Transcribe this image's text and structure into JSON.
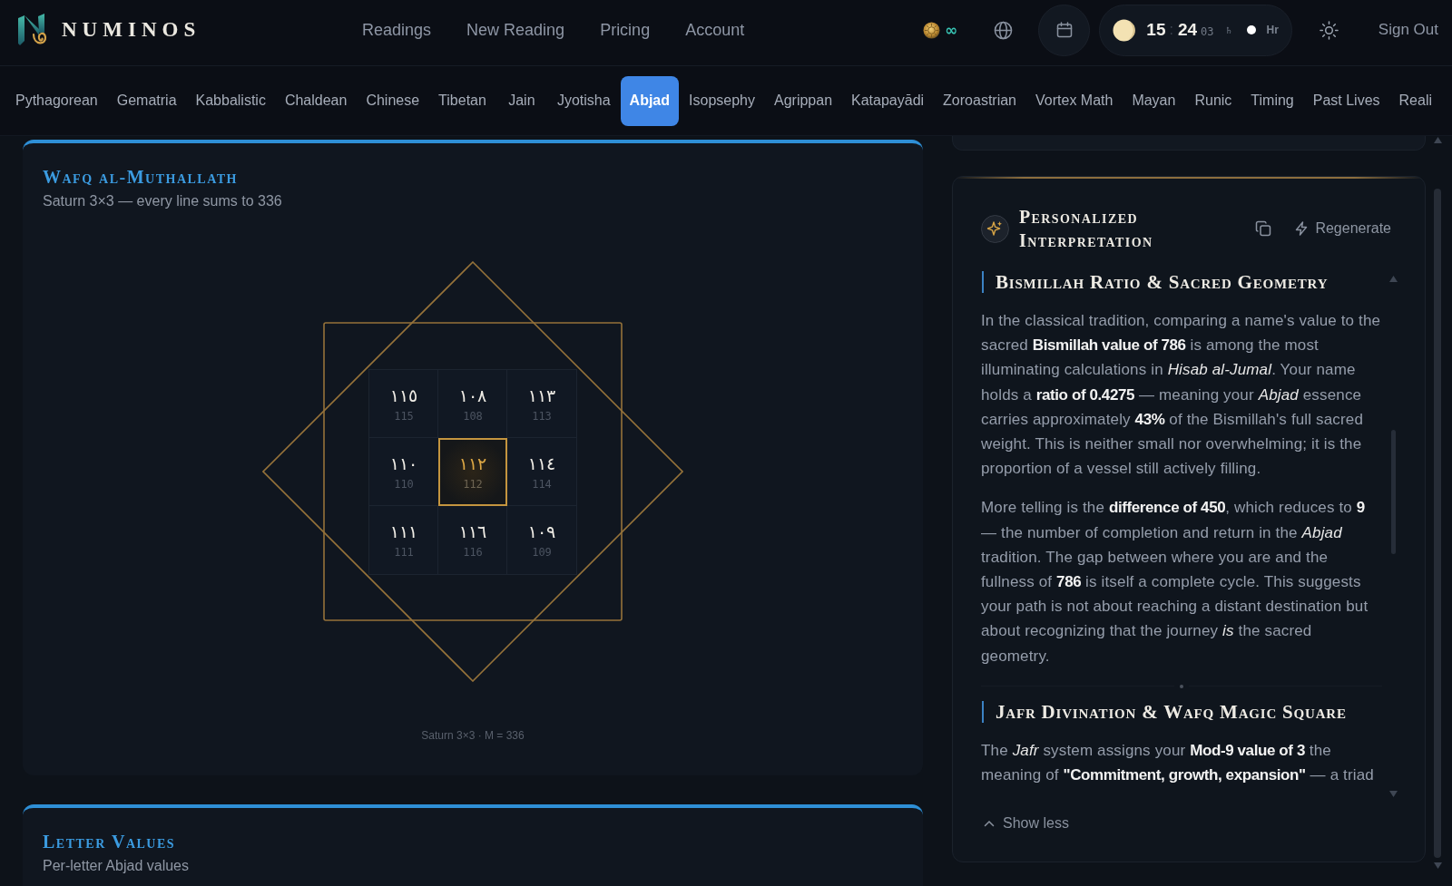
{
  "header": {
    "brand": "NUMINOS",
    "nav": [
      "Readings",
      "New Reading",
      "Pricing",
      "Account"
    ],
    "credits": "∞",
    "clock": {
      "hours": "15",
      "separator": ":",
      "minutes": "24",
      "seconds": "03",
      "planet": "♄",
      "hour_label": "Hr"
    },
    "sign_out": "Sign Out"
  },
  "systems_tabs": [
    {
      "label": "Pythagorean",
      "selected": false
    },
    {
      "label": "Gematria",
      "selected": false
    },
    {
      "label": "Kabbalistic",
      "selected": false
    },
    {
      "label": "Chaldean",
      "selected": false
    },
    {
      "label": "Chinese",
      "selected": false
    },
    {
      "label": "Tibetan",
      "selected": false
    },
    {
      "label": "Jain",
      "selected": false
    },
    {
      "label": "Jyotisha",
      "selected": false
    },
    {
      "label": "Abjad",
      "selected": true
    },
    {
      "label": "Isopsephy",
      "selected": false
    },
    {
      "label": "Agrippan",
      "selected": false
    },
    {
      "label": "Katapayādi",
      "selected": false
    },
    {
      "label": "Zoroastrian",
      "selected": false
    },
    {
      "label": "Vortex Math",
      "selected": false
    },
    {
      "label": "Mayan",
      "selected": false
    },
    {
      "label": "Runic",
      "selected": false
    },
    {
      "label": "Timing",
      "selected": false
    },
    {
      "label": "Past Lives",
      "selected": false
    },
    {
      "label": "Reali",
      "selected": false
    }
  ],
  "wafq_card": {
    "title": "Wafq al-Muthallath",
    "subtitle": "Saturn 3×3 — every line sums to 336",
    "rows": [
      {
        "cells": [
          {
            "arabic": "١١٥",
            "number": "115",
            "highlighted": false
          },
          {
            "arabic": "١٠٨",
            "number": "108",
            "highlighted": false
          },
          {
            "arabic": "١١٣",
            "number": "113",
            "highlighted": false
          }
        ]
      },
      {
        "cells": [
          {
            "arabic": "١١٠",
            "number": "110",
            "highlighted": false
          },
          {
            "arabic": "١١٢",
            "number": "112",
            "highlighted": true
          },
          {
            "arabic": "١١٤",
            "number": "114",
            "highlighted": false
          }
        ]
      },
      {
        "cells": [
          {
            "arabic": "١١١",
            "number": "111",
            "highlighted": false
          },
          {
            "arabic": "١١٦",
            "number": "116",
            "highlighted": false
          },
          {
            "arabic": "١٠٩",
            "number": "109",
            "highlighted": false
          }
        ]
      }
    ],
    "caption": "Saturn 3×3 · M = 336"
  },
  "letter_values_card": {
    "title": "Letter Values",
    "subtitle": "Per-letter Abjad values"
  },
  "interpretation": {
    "title": "Personalized Interpretation",
    "regenerate": "Regenerate",
    "sections": [
      {
        "heading": "Bismillah Ratio & Sacred Geometry",
        "paragraphs": [
          "In the classical tradition, comparing a name's value to the sacred **Bismillah value of 786** is among the most illuminating calculations in *Hisab al-Jumal*. Your name holds a **ratio of 0.4275** — meaning your *Abjad* essence carries approximately **43%** of the Bismillah's full sacred weight. This is neither small nor overwhelming; it is the proportion of a vessel still actively filling.",
          "More telling is the **difference of 450**, which reduces to **9** — the number of completion and return in the *Abjad* tradition. The gap between where you are and the fullness of **786** is itself a complete cycle. This suggests your path is not about reaching a distant destination but about recognizing that the journey *is* the sacred geometry."
        ]
      },
      {
        "heading": "Jafr Divination & Wafq Magic Square",
        "paragraphs": [
          "The *Jafr* system assigns your **Mod-9 value of 3** the meaning of **\"Commitment, growth, expansion\"** — a triad"
        ]
      }
    ],
    "show_less": "Show less"
  }
}
